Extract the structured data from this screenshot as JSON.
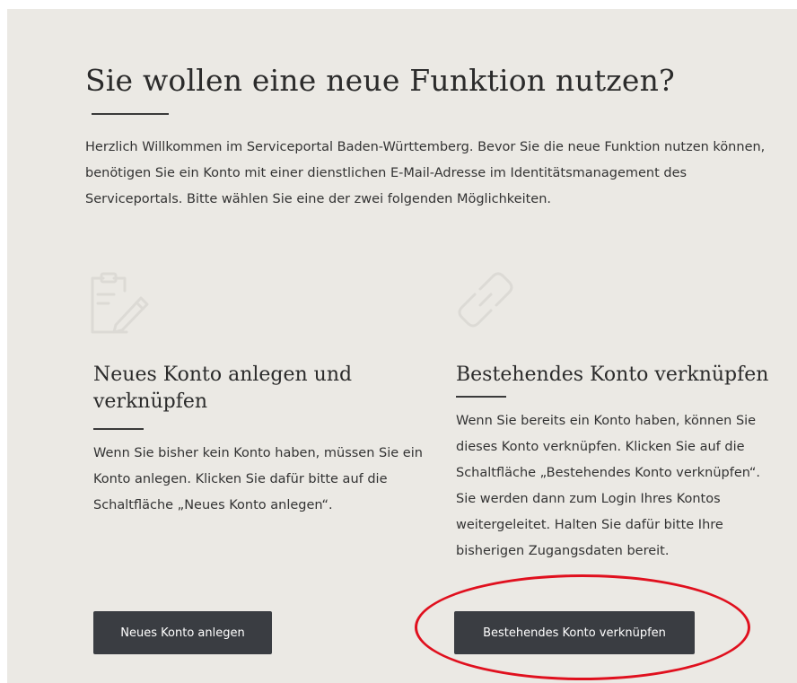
{
  "page": {
    "title": "Sie wollen eine neue Funktion nutzen?",
    "intro": "Herzlich Willkommen im Serviceportal Baden-Württemberg. Bevor Sie die neue Funktion nutzen können, benötigen Sie ein Konto mit einer dienstlichen E-Mail-Adresse im Identitätsmanagement des Serviceportals. Bitte wählen Sie eine der zwei folgenden Möglichkeiten."
  },
  "options": {
    "new_account": {
      "icon": "clipboard-edit-icon",
      "title": "Neues Konto anlegen und verknüpfen",
      "text": "Wenn Sie bisher kein Konto haben, müssen Sie ein Konto anlegen. Klicken Sie dafür bitte auf die Schaltfläche „Neues Konto anlegen“.",
      "button_label": "Neues Konto anlegen"
    },
    "existing_account": {
      "icon": "link-icon",
      "title": "Bestehendes Konto verknüpfen",
      "text": "Wenn Sie bereits ein Konto haben, können Sie dieses Konto verknüpfen. Klicken Sie auf die Schaltfläche „Bestehendes Konto verknüpfen“. Sie werden dann zum Login Ihres Kontos weitergeleitet. Halten Sie dafür bitte Ihre bisherigen Zugangsdaten bereit.",
      "button_label": "Bestehendes Konto verknüpfen"
    }
  },
  "colors": {
    "panel_background": "#ebe9e4",
    "button_background": "#3a3d42",
    "highlight_ring": "#e0101e"
  }
}
